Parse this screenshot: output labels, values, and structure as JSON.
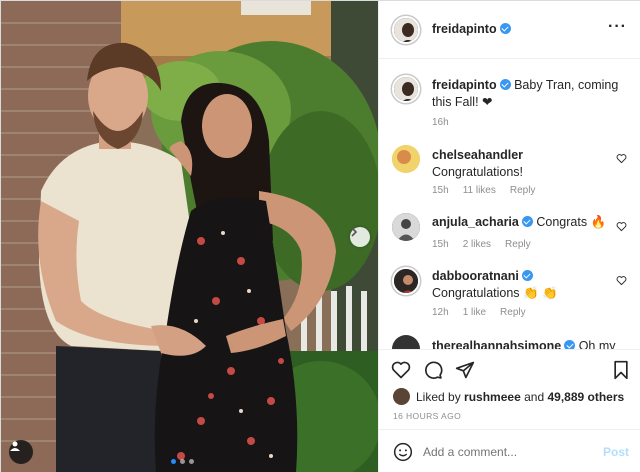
{
  "header": {
    "username": "freidapinto",
    "more_icon": "more-options-icon"
  },
  "caption": {
    "username": "freidapinto",
    "text": "Baby Tran, coming this Fall! ❤",
    "time": "16h"
  },
  "comments": [
    {
      "username": "chelseahandler",
      "verified": false,
      "text": "Congratulations!",
      "time": "15h",
      "likes": "11 likes",
      "reply": "Reply"
    },
    {
      "username": "anjula_acharia",
      "verified": true,
      "text": "Congrats 🔥",
      "time": "15h",
      "likes": "2 likes",
      "reply": "Reply"
    },
    {
      "username": "dabbooratnani",
      "verified": true,
      "text": "Congratulations 👏 👏",
      "time": "12h",
      "likes": "1 like",
      "reply": "Reply"
    },
    {
      "username": "therealhannahsimone",
      "verified": true,
      "text": "Oh my",
      "time": "",
      "likes": "",
      "reply": ""
    }
  ],
  "actions": {
    "liked_by_prefix": "Liked by",
    "liked_by_user": "rushmeee",
    "liked_by_and": "and",
    "liked_by_others": "49,889 others",
    "timestamp": "16 HOURS AGO"
  },
  "comment_box": {
    "placeholder": "Add a comment...",
    "post_label": "Post"
  },
  "carousel": {
    "slides": 3,
    "active": 0
  },
  "colors": {
    "accent": "#3897f0",
    "muted": "#8e8e8e",
    "post_disabled": "#b2dffc"
  }
}
